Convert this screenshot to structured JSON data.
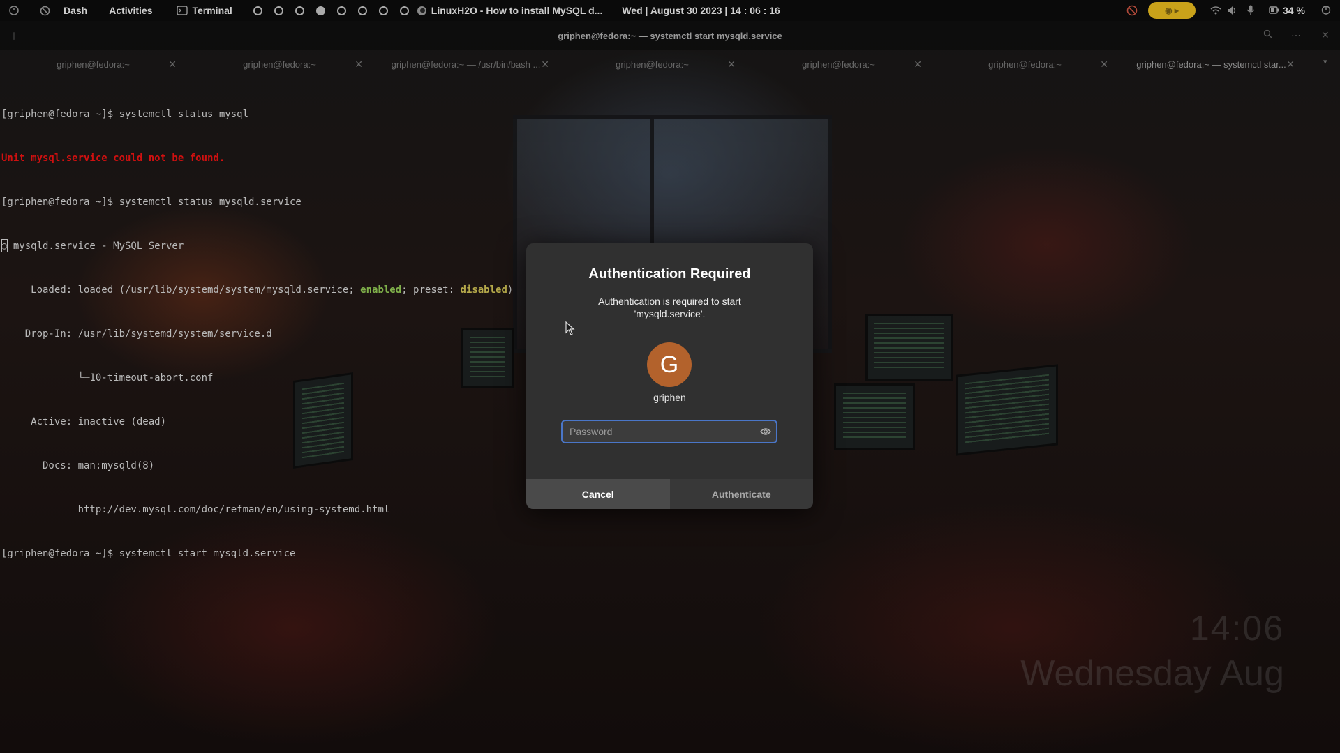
{
  "topbar": {
    "dash_label": "Dash",
    "activities_label": "Activities",
    "app_label": "Terminal",
    "window_title": "LinuxH2O - How to install MySQL d...",
    "datetime": "Wed | August 30 2023 | 14 : 06 : 16",
    "battery": "34 %"
  },
  "terminal": {
    "title": "griphen@fedora:~ — systemctl start mysqld.service",
    "tabs": [
      {
        "label": "griphen@fedora:~"
      },
      {
        "label": "griphen@fedora:~"
      },
      {
        "label": "griphen@fedora:~ — /usr/bin/bash ..."
      },
      {
        "label": "griphen@fedora:~"
      },
      {
        "label": "griphen@fedora:~"
      },
      {
        "label": "griphen@fedora:~"
      },
      {
        "label": "griphen@fedora:~ — systemctl star..."
      }
    ],
    "lines": {
      "l1": "[griphen@fedora ~]$ systemctl status mysql",
      "l2": "Unit mysql.service could not be found.",
      "l3": "[griphen@fedora ~]$ systemctl status mysqld.service",
      "l4": "○ mysqld.service - MySQL Server",
      "l5a": "     Loaded: loaded (/usr/lib/systemd/system/mysqld.service; ",
      "l5b": "enabled",
      "l5c": "; preset: ",
      "l5d": "disabled",
      "l5e": ")",
      "l6": "    Drop-In: /usr/lib/systemd/system/service.d",
      "l7": "             └─10-timeout-abort.conf",
      "l8": "     Active: inactive (dead)",
      "l9": "       Docs: man:mysqld(8)",
      "l10": "             http://dev.mysql.com/doc/refman/en/using-systemd.html",
      "l11": "[griphen@fedora ~]$ systemctl start mysqld.service"
    }
  },
  "dialog": {
    "title": "Authentication Required",
    "message_line1": "Authentication is required to start",
    "message_line2": "'mysqld.service'.",
    "avatar_initial": "G",
    "username": "griphen",
    "password_placeholder": "Password",
    "password_value": "",
    "cancel_label": "Cancel",
    "authenticate_label": "Authenticate",
    "avatar_color": "#b3622c",
    "focus_color": "#4a76c8"
  },
  "clock_widget": {
    "time": "14:06",
    "date": "Wednesday Aug"
  },
  "icons": [
    "power-icon",
    "blocked-icon",
    "terminal-icon",
    "firefox-icon",
    "wifi-icon",
    "volume-icon",
    "mic-icon",
    "battery-icon",
    "eye-icon",
    "new-tab-icon",
    "search-icon",
    "menu-icon",
    "close-icon"
  ]
}
